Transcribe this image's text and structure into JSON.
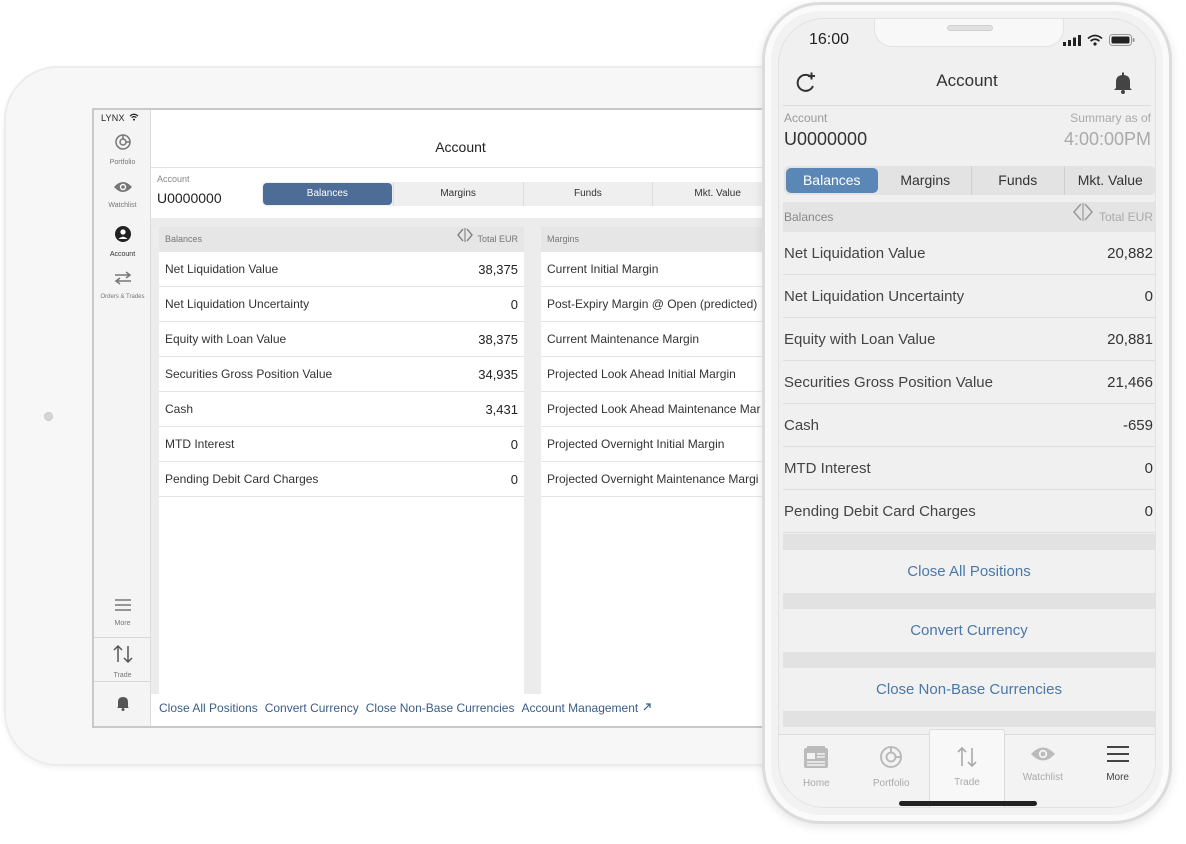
{
  "tablet": {
    "brand": "LYNX",
    "nav": {
      "portfolio": "Portfolio",
      "watchlist": "Watchlist",
      "account": "Account",
      "orders": "Orders & Trades",
      "more": "More",
      "trade": "Trade"
    },
    "title": "Account",
    "account_label": "Account",
    "account_id": "U0000000",
    "tabs": [
      "Balances",
      "Margins",
      "Funds",
      "Mkt. Value"
    ],
    "balances": {
      "header": "Balances",
      "total_label": "Total EUR",
      "rows": [
        {
          "label": "Net Liquidation Value",
          "value": "38,375"
        },
        {
          "label": "Net Liquidation Uncertainty",
          "value": "0"
        },
        {
          "label": "Equity with Loan Value",
          "value": "38,375"
        },
        {
          "label": "Securities Gross Position Value",
          "value": "34,935"
        },
        {
          "label": "Cash",
          "value": "3,431"
        },
        {
          "label": "MTD Interest",
          "value": "0"
        },
        {
          "label": "Pending Debit Card Charges",
          "value": "0"
        }
      ]
    },
    "margins": {
      "header": "Margins",
      "rows": [
        "Current Initial Margin",
        "Post-Expiry Margin @ Open (predicted)",
        "Current Maintenance Margin",
        "Projected Look Ahead Initial Margin",
        "Projected Look Ahead Maintenance Mar",
        "Projected Overnight Initial Margin",
        "Projected Overnight Maintenance Margi"
      ]
    },
    "links": [
      "Close All Positions",
      "Convert Currency",
      "Close Non-Base Currencies",
      "Account Management"
    ]
  },
  "phone": {
    "time": "16:00",
    "title": "Account",
    "account_label": "Account",
    "account_id": "U0000000",
    "summary_label": "Summary as of",
    "summary_time": "4:00:00PM",
    "tabs": [
      "Balances",
      "Margins",
      "Funds",
      "Mkt. Value"
    ],
    "section_header": "Balances",
    "total_label": "Total EUR",
    "rows": [
      {
        "label": "Net Liquidation Value",
        "value": "20,882"
      },
      {
        "label": "Net Liquidation Uncertainty",
        "value": "0"
      },
      {
        "label": "Equity with Loan Value",
        "value": "20,881"
      },
      {
        "label": "Securities Gross Position Value",
        "value": "21,466"
      },
      {
        "label": "Cash",
        "value": "-659"
      },
      {
        "label": "MTD Interest",
        "value": "0"
      },
      {
        "label": "Pending Debit Card Charges",
        "value": "0"
      }
    ],
    "actions": [
      "Close All Positions",
      "Convert Currency",
      "Close Non-Base Currencies"
    ],
    "tabbar": [
      "Home",
      "Portfolio",
      "Trade",
      "Watchlist",
      "More"
    ]
  },
  "colors": {
    "accent_tablet": "#4d6d96",
    "accent_phone": "#5a87b6",
    "link": "#3b5d87"
  }
}
